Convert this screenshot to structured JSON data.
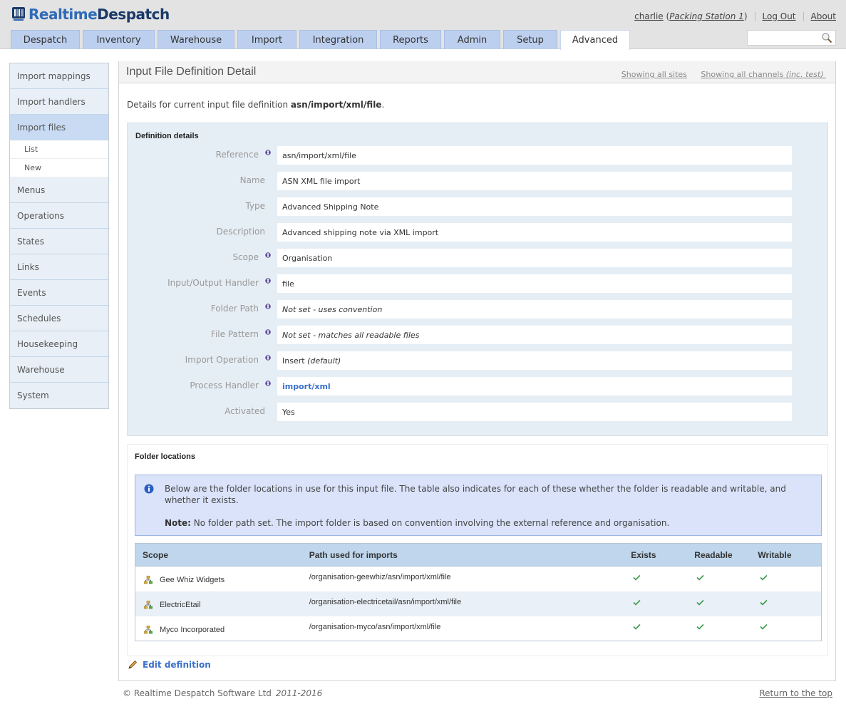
{
  "app": {
    "logo_part1": "Realtime",
    "logo_part2": "Despatch"
  },
  "user": {
    "username": "charlie",
    "station": "Packing Station 1",
    "logout_label": "Log Out",
    "about_label": "About"
  },
  "tabs": [
    {
      "label": "Despatch",
      "active": false
    },
    {
      "label": "Inventory",
      "active": false
    },
    {
      "label": "Warehouse",
      "active": false
    },
    {
      "label": "Import",
      "active": false
    },
    {
      "label": "Integration",
      "active": false
    },
    {
      "label": "Reports",
      "active": false
    },
    {
      "label": "Admin",
      "active": false
    },
    {
      "label": "Setup",
      "active": false
    },
    {
      "label": "Advanced",
      "active": true
    }
  ],
  "search": {
    "value": "",
    "icon": "search-icon"
  },
  "sidebar": {
    "items": [
      {
        "label": "Import mappings"
      },
      {
        "label": "Import handlers"
      },
      {
        "label": "Import files",
        "active": true
      },
      {
        "label": "Menus"
      },
      {
        "label": "Operations"
      },
      {
        "label": "States"
      },
      {
        "label": "Links"
      },
      {
        "label": "Events"
      },
      {
        "label": "Schedules"
      },
      {
        "label": "Housekeeping"
      },
      {
        "label": "Warehouse"
      },
      {
        "label": "System"
      }
    ],
    "subitems": [
      {
        "label": "List"
      },
      {
        "label": "New"
      }
    ]
  },
  "page": {
    "title": "Input File Definition Detail",
    "filter_sites": "Showing all sites",
    "filter_channels": "Showing all channels",
    "filter_channels_note": "(inc. test)",
    "intro_prefix": "Details for current input file definition ",
    "intro_ref": "asn/import/xml/file",
    "intro_suffix": "."
  },
  "definition": {
    "title": "Definition details",
    "fields": [
      {
        "label": "Reference",
        "value": "asn/import/xml/file",
        "info": true
      },
      {
        "label": "Name",
        "value": "ASN XML file import",
        "info": false
      },
      {
        "label": "Type",
        "value": "Advanced Shipping Note",
        "info": false
      },
      {
        "label": "Description",
        "value": "Advanced shipping note via XML import",
        "info": false
      },
      {
        "label": "Scope",
        "value": "Organisation",
        "info": true
      },
      {
        "label": "Input/Output Handler",
        "value": "file",
        "info": true
      },
      {
        "label": "Folder Path",
        "value": "Not set - uses convention",
        "info": true,
        "italic": true
      },
      {
        "label": "File Pattern",
        "value": "Not set - matches all readable files",
        "info": true,
        "italic": true
      },
      {
        "label": "Import Operation",
        "value": "Insert",
        "value_note": "(default)",
        "info": true
      },
      {
        "label": "Process Handler",
        "value": "import/xml",
        "info": true,
        "link": true
      },
      {
        "label": "Activated",
        "value": "Yes",
        "info": false
      }
    ]
  },
  "folders": {
    "title": "Folder locations",
    "note_text": "Below are the folder locations in use for this input file. The table also indicates for each of these whether the folder is readable and writable, and whether it exists.",
    "note_label": "Note:",
    "note_detail": " No folder path set. The import folder is based on convention involving the external reference and organisation.",
    "columns": [
      "Scope",
      "Path used for imports",
      "Exists",
      "Readable",
      "Writable"
    ],
    "rows": [
      {
        "scope": "Gee Whiz Widgets",
        "path": "/organisation-geewhiz/asn/import/xml/file",
        "exists": true,
        "readable": true,
        "writable": true
      },
      {
        "scope": "ElectricEtail",
        "path": "/organisation-electricetail/asn/import/xml/file",
        "exists": true,
        "readable": true,
        "writable": true
      },
      {
        "scope": "Myco Incorporated",
        "path": "/organisation-myco/asn/import/xml/file",
        "exists": true,
        "readable": true,
        "writable": true
      }
    ]
  },
  "actions": {
    "edit_label": "Edit definition"
  },
  "footer": {
    "copyright": "© Realtime Despatch Software Ltd",
    "years": "2011-2016",
    "return_top": "Return to the top"
  },
  "colors": {
    "accent_blue": "#3a6fc9",
    "tab_bg": "#bccfee",
    "check_green": "#3a9a4a"
  }
}
